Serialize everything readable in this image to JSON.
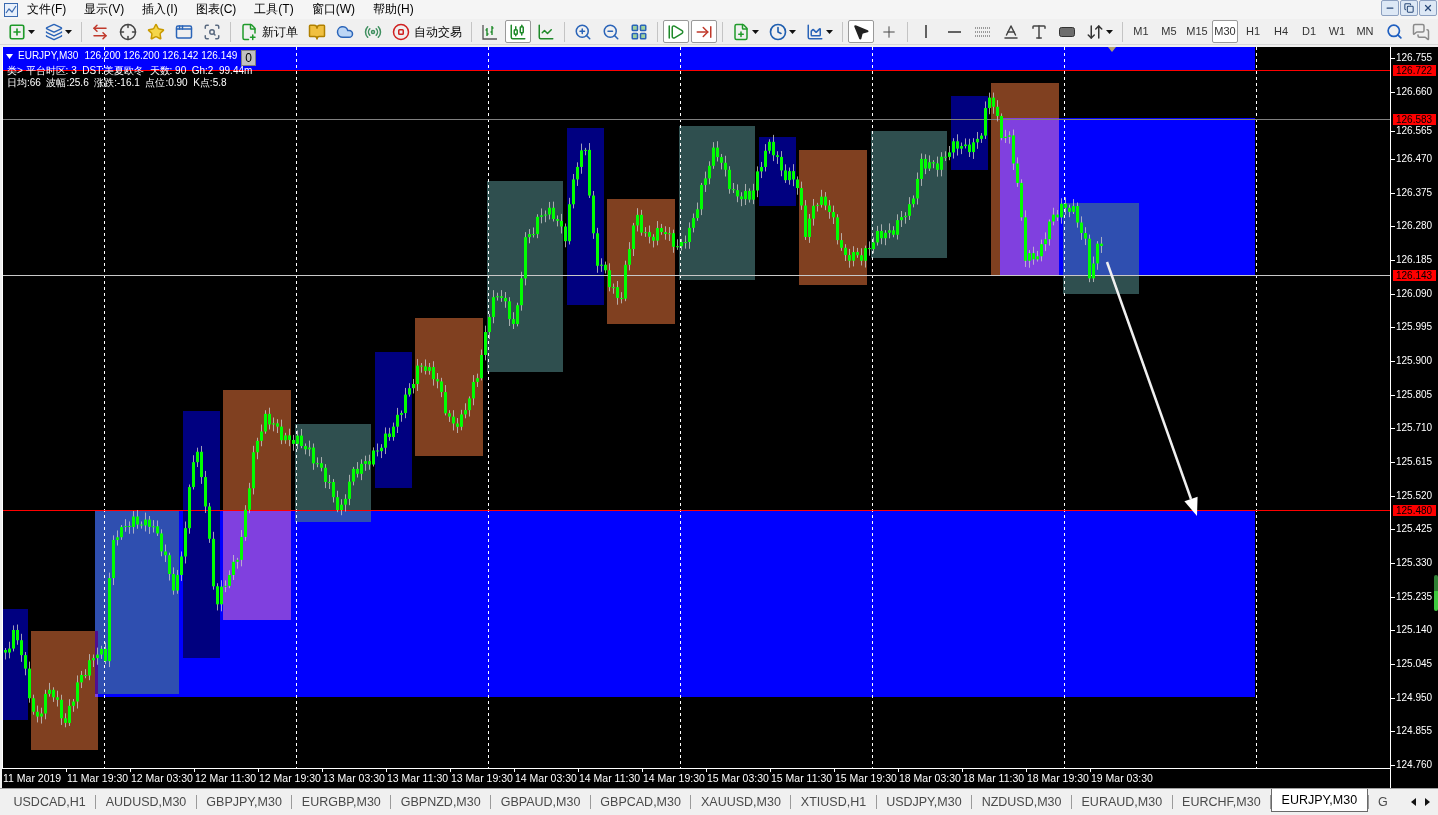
{
  "menu": [
    "文件(F)",
    "显示(V)",
    "插入(I)",
    "图表(C)",
    "工具(T)",
    "窗口(W)",
    "帮助(H)"
  ],
  "toolbar": [
    [
      {
        "kind": "newchart",
        "selected": false
      },
      {
        "kind": "profiles",
        "selected": false
      }
    ],
    [
      {
        "kind": "marketwatch",
        "selected": false
      },
      {
        "kind": "datawindow",
        "selected": false
      },
      {
        "kind": "navigator",
        "selected": false
      },
      {
        "kind": "terminal",
        "selected": false
      },
      {
        "kind": "tester",
        "selected": false
      }
    ],
    [
      {
        "kind": "neworder",
        "label": "新订单",
        "selected": false
      },
      {
        "kind": "editor",
        "selected": false
      },
      {
        "kind": "cloud",
        "selected": false
      },
      {
        "kind": "signals",
        "selected": false
      },
      {
        "kind": "autotrading",
        "label": "自动交易",
        "selected": false
      }
    ],
    [
      {
        "kind": "bars",
        "selected": false
      },
      {
        "kind": "candles",
        "selected": true
      },
      {
        "kind": "line",
        "selected": false
      }
    ],
    [
      {
        "kind": "zoomin",
        "selected": false
      },
      {
        "kind": "zoomout",
        "selected": false
      },
      {
        "kind": "tile",
        "selected": false
      }
    ],
    [
      {
        "kind": "autoscroll",
        "selected": true
      },
      {
        "kind": "shift",
        "selected": true
      }
    ],
    [
      {
        "kind": "indicators",
        "selected": false
      },
      {
        "kind": "periods",
        "selected": false
      },
      {
        "kind": "templates",
        "selected": false
      }
    ],
    [
      {
        "kind": "cursor",
        "selected": true
      },
      {
        "kind": "crosshair",
        "selected": false
      }
    ],
    [
      {
        "kind": "vline",
        "selected": false
      },
      {
        "kind": "hline",
        "selected": false
      },
      {
        "kind": "fibo",
        "selected": false
      },
      {
        "kind": "text",
        "selected": false
      },
      {
        "kind": "label",
        "selected": false
      },
      {
        "kind": "rectangle",
        "selected": false
      },
      {
        "kind": "arrows",
        "selected": false
      }
    ]
  ],
  "timeframes": [
    {
      "label": "M1",
      "selected": false
    },
    {
      "label": "M5",
      "selected": false
    },
    {
      "label": "M15",
      "selected": false
    },
    {
      "label": "M30",
      "selected": true
    },
    {
      "label": "H1",
      "selected": false
    },
    {
      "label": "H4",
      "selected": false
    },
    {
      "label": "D1",
      "selected": false
    },
    {
      "label": "W1",
      "selected": false
    },
    {
      "label": "MN",
      "selected": false
    }
  ],
  "chart": {
    "symbol": "EURJPY,M30",
    "prices": "126.200 126.200 126.142 126.149",
    "counter": "0",
    "info_lines": [
      "类> 平台时区: 3  DST:美夏欧冬  天数: 90  Gh:2  99.44m",
      "日均:66  波幅:25.6  涨跌:-16.1  点位:0.90  K点:5.8"
    ],
    "price_axis": [
      "126.755",
      "126.660",
      "126.565",
      "126.470",
      "126.375",
      "126.280",
      "126.185",
      "126.090",
      "125.995",
      "125.900",
      "125.805",
      "125.710",
      "125.615",
      "125.520",
      "125.425",
      "125.330",
      "125.235",
      "125.140",
      "125.045",
      "124.950",
      "124.855",
      "124.760"
    ],
    "price_marks": [
      "126.722",
      "126.583",
      "126.143",
      "125.480"
    ],
    "time_axis": [
      "11 Mar 2019",
      "11 Mar 19:30",
      "12 Mar 03:30",
      "12 Mar 11:30",
      "12 Mar 19:30",
      "13 Mar 03:30",
      "13 Mar 11:30",
      "13 Mar 19:30",
      "14 Mar 03:30",
      "14 Mar 11:30",
      "14 Mar 19:30",
      "15 Mar 03:30",
      "15 Mar 11:30",
      "15 Mar 19:30",
      "18 Mar 03:30",
      "18 Mar 11:30",
      "18 Mar 19:30",
      "19 Mar 03:30"
    ]
  },
  "tabs": [
    {
      "label": "USDCAD,H1",
      "selected": false
    },
    {
      "label": "AUDUSD,M30",
      "selected": false
    },
    {
      "label": "GBPJPY,M30",
      "selected": false
    },
    {
      "label": "EURGBP,M30",
      "selected": false
    },
    {
      "label": "GBPNZD,M30",
      "selected": false
    },
    {
      "label": "GBPAUD,M30",
      "selected": false
    },
    {
      "label": "GBPCAD,M30",
      "selected": false
    },
    {
      "label": "XAUUSD,M30",
      "selected": false
    },
    {
      "label": "XTIUSD,H1",
      "selected": false
    },
    {
      "label": "USDJPY,M30",
      "selected": false
    },
    {
      "label": "NZDUSD,M30",
      "selected": false
    },
    {
      "label": "EURAUD,M30",
      "selected": false
    },
    {
      "label": "EURCHF,M30",
      "selected": false
    },
    {
      "label": "EURJPY,M30",
      "selected": true
    },
    {
      "label": "G",
      "selected": false
    }
  ]
}
